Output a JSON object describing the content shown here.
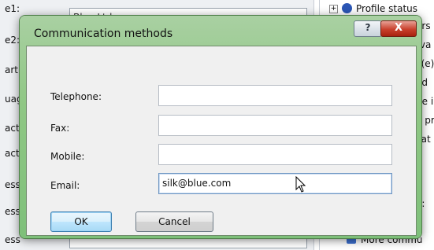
{
  "background": {
    "left_labels": [
      "e1:",
      "e2:",
      "artm",
      "uag",
      "act",
      "act",
      "ess",
      "ess",
      "ess"
    ],
    "company_value": "Blue Ltd",
    "right_lines": [
      "Profile status",
      "ers",
      "rva",
      "c(e)",
      "ad",
      "de i",
      "e pr",
      "cat",
      "e",
      "e:",
      "More commu"
    ]
  },
  "dialog": {
    "title": "Communication methods",
    "help_glyph": "?",
    "close_glyph": "X",
    "fields": [
      {
        "label": "Telephone:",
        "value": ""
      },
      {
        "label": "Fax:",
        "value": ""
      },
      {
        "label": "Mobile:",
        "value": ""
      },
      {
        "label": "Email:",
        "value": "silk@blue.com"
      }
    ],
    "ok_label": "OK",
    "cancel_label": "Cancel"
  },
  "colors": {
    "frame_green": "#8fc784",
    "close_red": "#c8402c",
    "focus_blue": "#6e96c2"
  }
}
